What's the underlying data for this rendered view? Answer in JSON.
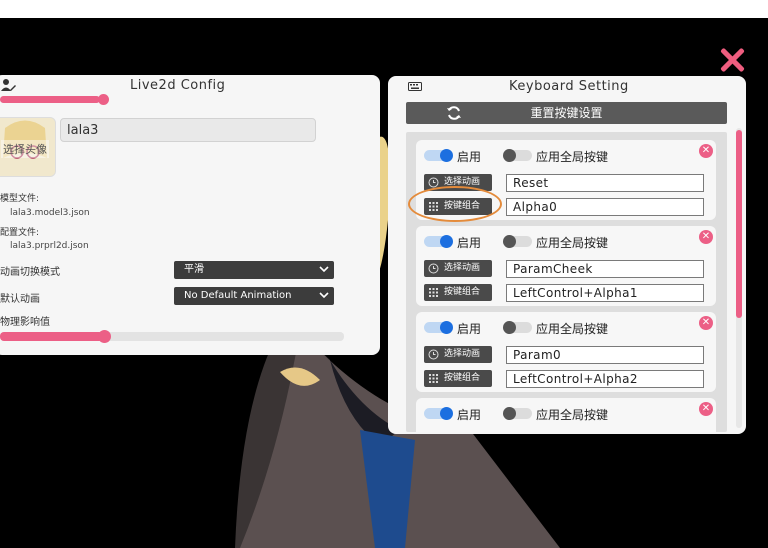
{
  "colors": {
    "accent": "#ec5f86",
    "toggle_on": "#1c6fe0",
    "button_dark": "#4a4a4a",
    "annotation": "#e48b3b"
  },
  "left_panel": {
    "title": "Live2d Config",
    "avatar_button": "选择头像",
    "name_value": "lala3",
    "model_file_label": "模型文件:",
    "model_file_value": "lala3.model3.json",
    "config_file_label": "配置文件:",
    "config_file_value": "lala3.prprl2d.json",
    "anim_mode_label": "动画切换模式",
    "anim_mode_value": "平滑",
    "default_anim_label": "默认动画",
    "default_anim_value": "No Default Animation",
    "physics_label": "物理影响值",
    "top_slider_fraction": 0.27,
    "physics_slider_fraction": 0.3
  },
  "right_panel": {
    "title": "Keyboard Setting",
    "reset_label": "重置按键设置",
    "enable_label": "启用",
    "global_label": "应用全局按键",
    "select_anim_label": "选择动画",
    "key_combo_label": "按键组合",
    "bindings": [
      {
        "enabled": true,
        "global": false,
        "animation": "Reset",
        "keys": "Alpha0"
      },
      {
        "enabled": true,
        "global": false,
        "animation": "ParamCheek",
        "keys": "LeftControl+Alpha1"
      },
      {
        "enabled": true,
        "global": false,
        "animation": "Param0",
        "keys": "LeftControl+Alpha2"
      },
      {
        "enabled": true,
        "global": false,
        "animation": "",
        "keys": ""
      }
    ]
  }
}
